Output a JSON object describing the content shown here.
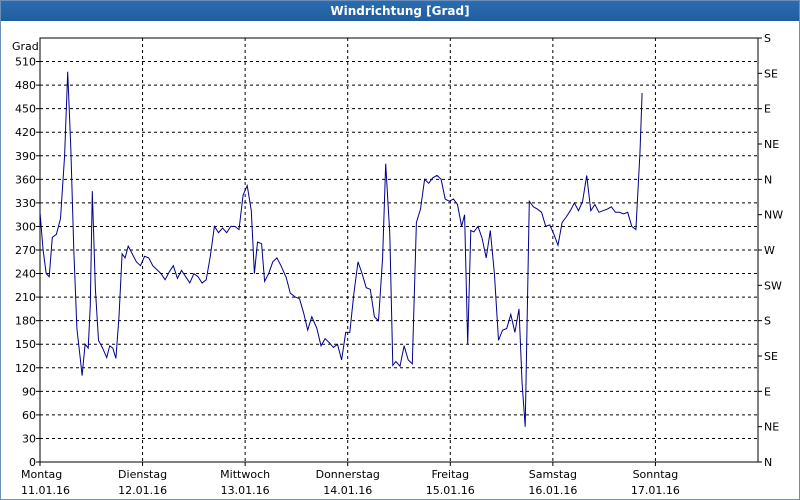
{
  "window": {
    "title": "Windrichtung [Grad]"
  },
  "chart_data": {
    "type": "line",
    "title": "Windrichtung [Grad]",
    "ylabel": "Grad",
    "ylim": [
      0,
      540
    ],
    "xlim": [
      0,
      7
    ],
    "grid": true,
    "y_ticks": [
      0,
      30,
      60,
      90,
      120,
      150,
      180,
      210,
      240,
      270,
      300,
      330,
      360,
      390,
      420,
      450,
      480,
      510
    ],
    "y_ticks_right": [
      {
        "value": 0,
        "label": "N"
      },
      {
        "value": 45,
        "label": "NE"
      },
      {
        "value": 90,
        "label": "E"
      },
      {
        "value": 135,
        "label": "SE"
      },
      {
        "value": 180,
        "label": "S"
      },
      {
        "value": 225,
        "label": "SW"
      },
      {
        "value": 270,
        "label": "W"
      },
      {
        "value": 315,
        "label": "NW"
      },
      {
        "value": 360,
        "label": "N"
      },
      {
        "value": 405,
        "label": "NE"
      },
      {
        "value": 450,
        "label": "E"
      },
      {
        "value": 495,
        "label": "SE"
      },
      {
        "value": 540,
        "label": "S"
      }
    ],
    "x_ticks": [
      {
        "day": "Montag",
        "date": "11.01.16"
      },
      {
        "day": "Dienstag",
        "date": "12.01.16"
      },
      {
        "day": "Mittwoch",
        "date": "13.01.16"
      },
      {
        "day": "Donnerstag",
        "date": "14.01.16"
      },
      {
        "day": "Freitag",
        "date": "15.01.16"
      },
      {
        "day": "Samstag",
        "date": "16.01.16"
      },
      {
        "day": "Sonntag",
        "date": "17.01.16"
      }
    ],
    "series": [
      {
        "color": "#00008b",
        "points": [
          [
            0.0,
            318
          ],
          [
            0.03,
            270
          ],
          [
            0.06,
            240
          ],
          [
            0.09,
            236
          ],
          [
            0.12,
            286
          ],
          [
            0.16,
            290
          ],
          [
            0.2,
            310
          ],
          [
            0.24,
            390
          ],
          [
            0.27,
            497
          ],
          [
            0.3,
            400
          ],
          [
            0.33,
            270
          ],
          [
            0.36,
            170
          ],
          [
            0.39,
            135
          ],
          [
            0.41,
            110
          ],
          [
            0.44,
            150
          ],
          [
            0.47,
            145
          ],
          [
            0.49,
            200
          ],
          [
            0.51,
            345
          ],
          [
            0.54,
            220
          ],
          [
            0.57,
            155
          ],
          [
            0.61,
            145
          ],
          [
            0.65,
            133
          ],
          [
            0.68,
            148
          ],
          [
            0.71,
            145
          ],
          [
            0.74,
            132
          ],
          [
            0.77,
            185
          ],
          [
            0.8,
            265
          ],
          [
            0.83,
            260
          ],
          [
            0.86,
            275
          ],
          [
            0.9,
            265
          ],
          [
            0.94,
            255
          ],
          [
            0.98,
            250
          ],
          [
            1.02,
            262
          ],
          [
            1.06,
            260
          ],
          [
            1.1,
            250
          ],
          [
            1.14,
            245
          ],
          [
            1.18,
            240
          ],
          [
            1.22,
            232
          ],
          [
            1.26,
            242
          ],
          [
            1.3,
            250
          ],
          [
            1.34,
            234
          ],
          [
            1.38,
            244
          ],
          [
            1.42,
            236
          ],
          [
            1.46,
            228
          ],
          [
            1.5,
            240
          ],
          [
            1.54,
            236
          ],
          [
            1.58,
            228
          ],
          [
            1.62,
            232
          ],
          [
            1.66,
            262
          ],
          [
            1.7,
            300
          ],
          [
            1.74,
            292
          ],
          [
            1.78,
            298
          ],
          [
            1.82,
            292
          ],
          [
            1.86,
            300
          ],
          [
            1.9,
            300
          ],
          [
            1.94,
            296
          ],
          [
            1.98,
            340
          ],
          [
            2.02,
            352
          ],
          [
            2.06,
            320
          ],
          [
            2.09,
            240
          ],
          [
            2.12,
            280
          ],
          [
            2.16,
            278
          ],
          [
            2.19,
            230
          ],
          [
            2.23,
            240
          ],
          [
            2.27,
            255
          ],
          [
            2.31,
            260
          ],
          [
            2.35,
            250
          ],
          [
            2.4,
            235
          ],
          [
            2.44,
            215
          ],
          [
            2.49,
            210
          ],
          [
            2.53,
            208
          ],
          [
            2.57,
            190
          ],
          [
            2.61,
            168
          ],
          [
            2.65,
            185
          ],
          [
            2.7,
            170
          ],
          [
            2.74,
            148
          ],
          [
            2.78,
            157
          ],
          [
            2.82,
            152
          ],
          [
            2.86,
            146
          ],
          [
            2.9,
            150
          ],
          [
            2.94,
            130
          ],
          [
            2.98,
            165
          ],
          [
            3.02,
            165
          ],
          [
            3.06,
            215
          ],
          [
            3.1,
            255
          ],
          [
            3.14,
            240
          ],
          [
            3.18,
            222
          ],
          [
            3.22,
            220
          ],
          [
            3.26,
            185
          ],
          [
            3.3,
            180
          ],
          [
            3.34,
            260
          ],
          [
            3.37,
            380
          ],
          [
            3.41,
            290
          ],
          [
            3.44,
            123
          ],
          [
            3.47,
            128
          ],
          [
            3.51,
            122
          ],
          [
            3.55,
            148
          ],
          [
            3.59,
            130
          ],
          [
            3.63,
            125
          ],
          [
            3.67,
            305
          ],
          [
            3.71,
            322
          ],
          [
            3.75,
            360
          ],
          [
            3.79,
            355
          ],
          [
            3.83,
            362
          ],
          [
            3.87,
            365
          ],
          [
            3.91,
            360
          ],
          [
            3.95,
            335
          ],
          [
            3.99,
            332
          ],
          [
            4.03,
            335
          ],
          [
            4.07,
            328
          ],
          [
            4.11,
            300
          ],
          [
            4.14,
            315
          ],
          [
            4.17,
            150
          ],
          [
            4.2,
            295
          ],
          [
            4.23,
            293
          ],
          [
            4.27,
            300
          ],
          [
            4.31,
            285
          ],
          [
            4.35,
            260
          ],
          [
            4.39,
            295
          ],
          [
            4.43,
            240
          ],
          [
            4.47,
            155
          ],
          [
            4.51,
            168
          ],
          [
            4.55,
            170
          ],
          [
            4.59,
            188
          ],
          [
            4.63,
            165
          ],
          [
            4.67,
            195
          ],
          [
            4.7,
            100
          ],
          [
            4.73,
            45
          ],
          [
            4.77,
            332
          ],
          [
            4.81,
            325
          ],
          [
            4.85,
            322
          ],
          [
            4.89,
            318
          ],
          [
            4.93,
            300
          ],
          [
            4.97,
            302
          ],
          [
            5.01,
            290
          ],
          [
            5.05,
            276
          ],
          [
            5.09,
            305
          ],
          [
            5.13,
            312
          ],
          [
            5.17,
            320
          ],
          [
            5.21,
            330
          ],
          [
            5.25,
            320
          ],
          [
            5.29,
            332
          ],
          [
            5.33,
            365
          ],
          [
            5.37,
            320
          ],
          [
            5.41,
            328
          ],
          [
            5.45,
            318
          ],
          [
            5.49,
            320
          ],
          [
            5.53,
            322
          ],
          [
            5.57,
            325
          ],
          [
            5.61,
            318
          ],
          [
            5.65,
            318
          ],
          [
            5.69,
            316
          ],
          [
            5.73,
            318
          ],
          [
            5.77,
            300
          ],
          [
            5.81,
            296
          ],
          [
            5.85,
            395
          ],
          [
            5.87,
            470
          ]
        ]
      }
    ]
  }
}
